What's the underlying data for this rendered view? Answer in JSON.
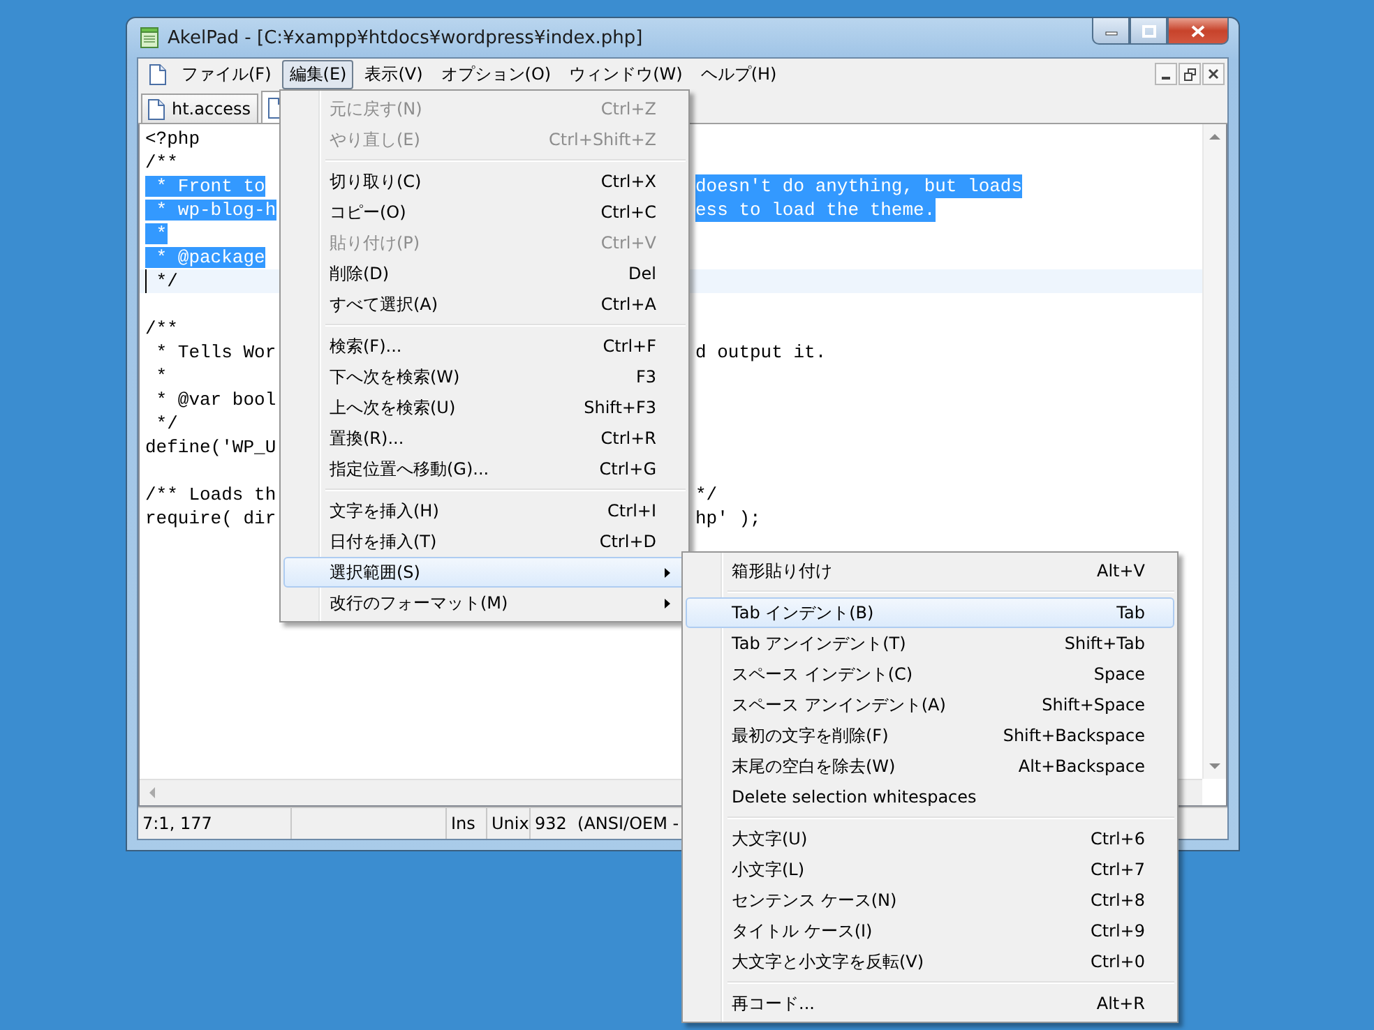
{
  "window": {
    "title": "AkelPad - [C:¥xampp¥htdocs¥wordpress¥index.php]"
  },
  "menubar": [
    {
      "label": "ファイル(F)",
      "selected": false
    },
    {
      "label": "編集(E)",
      "selected": true
    },
    {
      "label": "表示(V)",
      "selected": false
    },
    {
      "label": "オプション(O)",
      "selected": false
    },
    {
      "label": "ウィンドウ(W)",
      "selected": false
    },
    {
      "label": "ヘルプ(H)",
      "selected": false
    }
  ],
  "tabs": [
    {
      "label": "ht.access",
      "selected": false
    },
    {
      "selected": true
    }
  ],
  "editor": {
    "lines": [
      {
        "kind": "code",
        "text": "<?php",
        "selected": false,
        "current": false
      },
      {
        "kind": "code",
        "text": "/**",
        "selected": false,
        "current": false
      },
      {
        "kind": "code",
        "text": " * Front to",
        "right": "doesn't do anything, but loads",
        "selected": true,
        "current": false
      },
      {
        "kind": "code",
        "text": " * wp-blog-h",
        "right": "ess to load the theme.",
        "selected": true,
        "current": false
      },
      {
        "kind": "code",
        "text": " *",
        "selected": true,
        "current": false
      },
      {
        "kind": "code",
        "text": " * @package",
        "selected": true,
        "current": false
      },
      {
        "kind": "code",
        "text": " */",
        "selected": false,
        "current": true
      },
      {
        "kind": "blank",
        "current": false
      },
      {
        "kind": "code",
        "text": "/**",
        "selected": false,
        "current": false
      },
      {
        "kind": "code",
        "text": " * Tells Wor",
        "right": "d output it.",
        "selected": false,
        "current": false
      },
      {
        "kind": "code",
        "text": " *",
        "selected": false,
        "current": false
      },
      {
        "kind": "code",
        "text": " * @var bool",
        "selected": false,
        "current": false
      },
      {
        "kind": "code",
        "text": " */",
        "selected": false,
        "current": false
      },
      {
        "kind": "code",
        "text": "define('WP_U",
        "selected": false,
        "current": false
      },
      {
        "kind": "blank",
        "current": false
      },
      {
        "kind": "code",
        "text": "/** Loads th",
        "right": "*/",
        "selected": false,
        "current": false
      },
      {
        "kind": "code",
        "text": "require( dir",
        "right": "hp' );",
        "selected": false,
        "current": false
      }
    ]
  },
  "status_bar": [
    "7:1, 177",
    "Ins",
    "Unix",
    "932  (ANSI/OEM -"
  ],
  "edit_menu": {
    "items": [
      {
        "kind": "item",
        "label": "元に戻す(N)",
        "shortcut": "Ctrl+Z",
        "disabled": true,
        "selected": false,
        "submenu": false
      },
      {
        "kind": "item",
        "label": "やり直し(E)",
        "shortcut": "Ctrl+Shift+Z",
        "disabled": true,
        "selected": false,
        "submenu": false
      },
      {
        "kind": "separator"
      },
      {
        "kind": "item",
        "label": "切り取り(C)",
        "shortcut": "Ctrl+X",
        "disabled": false,
        "selected": false,
        "submenu": false
      },
      {
        "kind": "item",
        "label": "コピー(O)",
        "shortcut": "Ctrl+C",
        "disabled": false,
        "selected": false,
        "submenu": false
      },
      {
        "kind": "item",
        "label": "貼り付け(P)",
        "shortcut": "Ctrl+V",
        "disabled": true,
        "selected": false,
        "submenu": false
      },
      {
        "kind": "item",
        "label": "削除(D)",
        "shortcut": "Del",
        "disabled": false,
        "selected": false,
        "submenu": false
      },
      {
        "kind": "item",
        "label": "すべて選択(A)",
        "shortcut": "Ctrl+A",
        "disabled": false,
        "selected": false,
        "submenu": false
      },
      {
        "kind": "separator"
      },
      {
        "kind": "item",
        "label": "検索(F)...",
        "shortcut": "Ctrl+F",
        "disabled": false,
        "selected": false,
        "submenu": false
      },
      {
        "kind": "item",
        "label": "下へ次を検索(W)",
        "shortcut": "F3",
        "disabled": false,
        "selected": false,
        "submenu": false
      },
      {
        "kind": "item",
        "label": "上へ次を検索(U)",
        "shortcut": "Shift+F3",
        "disabled": false,
        "selected": false,
        "submenu": false
      },
      {
        "kind": "item",
        "label": "置換(R)...",
        "shortcut": "Ctrl+R",
        "disabled": false,
        "selected": false,
        "submenu": false
      },
      {
        "kind": "item",
        "label": "指定位置へ移動(G)...",
        "shortcut": "Ctrl+G",
        "disabled": false,
        "selected": false,
        "submenu": false
      },
      {
        "kind": "separator"
      },
      {
        "kind": "item",
        "label": "文字を挿入(H)",
        "shortcut": "Ctrl+I",
        "disabled": false,
        "selected": false,
        "submenu": false
      },
      {
        "kind": "item",
        "label": "日付を挿入(T)",
        "shortcut": "Ctrl+D",
        "disabled": false,
        "selected": false,
        "submenu": false
      },
      {
        "kind": "item",
        "label": "選択範囲(S)",
        "disabled": false,
        "selected": true,
        "submenu": true
      },
      {
        "kind": "item",
        "label": "改行のフォーマット(M)",
        "disabled": false,
        "selected": false,
        "submenu": true
      }
    ]
  },
  "selection_submenu": {
    "items": [
      {
        "kind": "item",
        "label": "箱形貼り付け",
        "shortcut": "Alt+V",
        "disabled": false,
        "selected": false,
        "submenu": false
      },
      {
        "kind": "separator"
      },
      {
        "kind": "item",
        "label": "Tab インデント(B)",
        "shortcut": "Tab",
        "disabled": false,
        "selected": true,
        "submenu": false
      },
      {
        "kind": "item",
        "label": "Tab アンインデント(T)",
        "shortcut": "Shift+Tab",
        "disabled": false,
        "selected": false,
        "submenu": false
      },
      {
        "kind": "item",
        "label": "スペース インデント(C)",
        "shortcut": "Space",
        "disabled": false,
        "selected": false,
        "submenu": false
      },
      {
        "kind": "item",
        "label": "スペース アンインデント(A)",
        "shortcut": "Shift+Space",
        "disabled": false,
        "selected": false,
        "submenu": false
      },
      {
        "kind": "item",
        "label": "最初の文字を削除(F)",
        "shortcut": "Shift+Backspace",
        "disabled": false,
        "selected": false,
        "submenu": false
      },
      {
        "kind": "item",
        "label": "末尾の空白を除去(W)",
        "shortcut": "Alt+Backspace",
        "disabled": false,
        "selected": false,
        "submenu": false
      },
      {
        "kind": "item",
        "label": "Delete selection whitespaces",
        "disabled": false,
        "selected": false,
        "submenu": false
      },
      {
        "kind": "separator"
      },
      {
        "kind": "item",
        "label": "大文字(U)",
        "shortcut": "Ctrl+6",
        "disabled": false,
        "selected": false,
        "submenu": false
      },
      {
        "kind": "item",
        "label": "小文字(L)",
        "shortcut": "Ctrl+7",
        "disabled": false,
        "selected": false,
        "submenu": false
      },
      {
        "kind": "item",
        "label": "センテンス ケース(N)",
        "shortcut": "Ctrl+8",
        "disabled": false,
        "selected": false,
        "submenu": false
      },
      {
        "kind": "item",
        "label": "タイトル ケース(I)",
        "shortcut": "Ctrl+9",
        "disabled": false,
        "selected": false,
        "submenu": false
      },
      {
        "kind": "item",
        "label": "大文字と小文字を反転(V)",
        "shortcut": "Ctrl+0",
        "disabled": false,
        "selected": false,
        "submenu": false
      },
      {
        "kind": "separator"
      },
      {
        "kind": "item",
        "label": "再コード...",
        "shortcut": "Alt+R",
        "disabled": false,
        "selected": false,
        "submenu": false
      }
    ]
  }
}
